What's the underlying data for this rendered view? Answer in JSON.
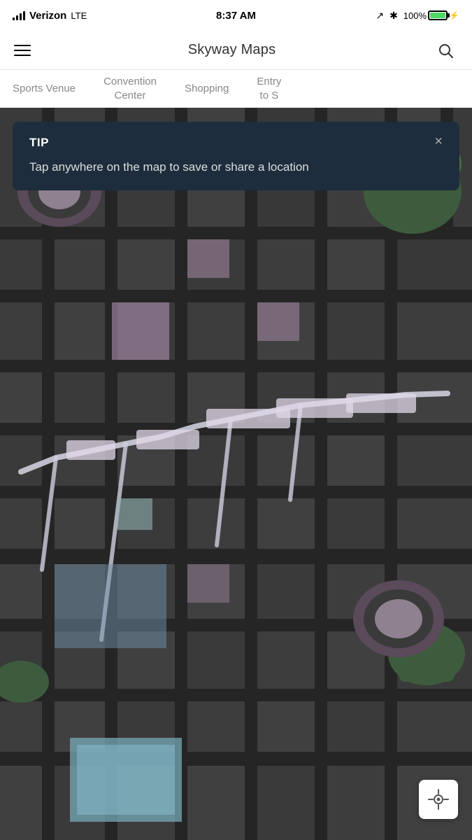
{
  "status_bar": {
    "carrier": "Verizon",
    "network": "LTE",
    "time": "8:37 AM",
    "battery_percent": "100%"
  },
  "header": {
    "title": "Skyway Maps",
    "menu_label": "Menu",
    "search_label": "Search"
  },
  "category_tabs": [
    {
      "id": "sports-venue",
      "label": "Sports Venue"
    },
    {
      "id": "convention-center",
      "label": "Convention\nCenter"
    },
    {
      "id": "shopping",
      "label": "Shopping"
    },
    {
      "id": "entry-to-s",
      "label": "Entry\nto S"
    }
  ],
  "tip": {
    "header_label": "TIP",
    "body_text": "Tap anywhere on the map to save or share a location",
    "close_label": "×"
  },
  "location_button": {
    "label": "My Location"
  },
  "colors": {
    "map_bg": "#3a3a3a",
    "skyway_path": "#e8e8f0",
    "building_light": "#c8b8c8",
    "building_blue": "#8fbfbf",
    "building_accent": "#d4c4d4",
    "green_area": "#4a6b4a",
    "dark_road": "#2a2a2a"
  }
}
